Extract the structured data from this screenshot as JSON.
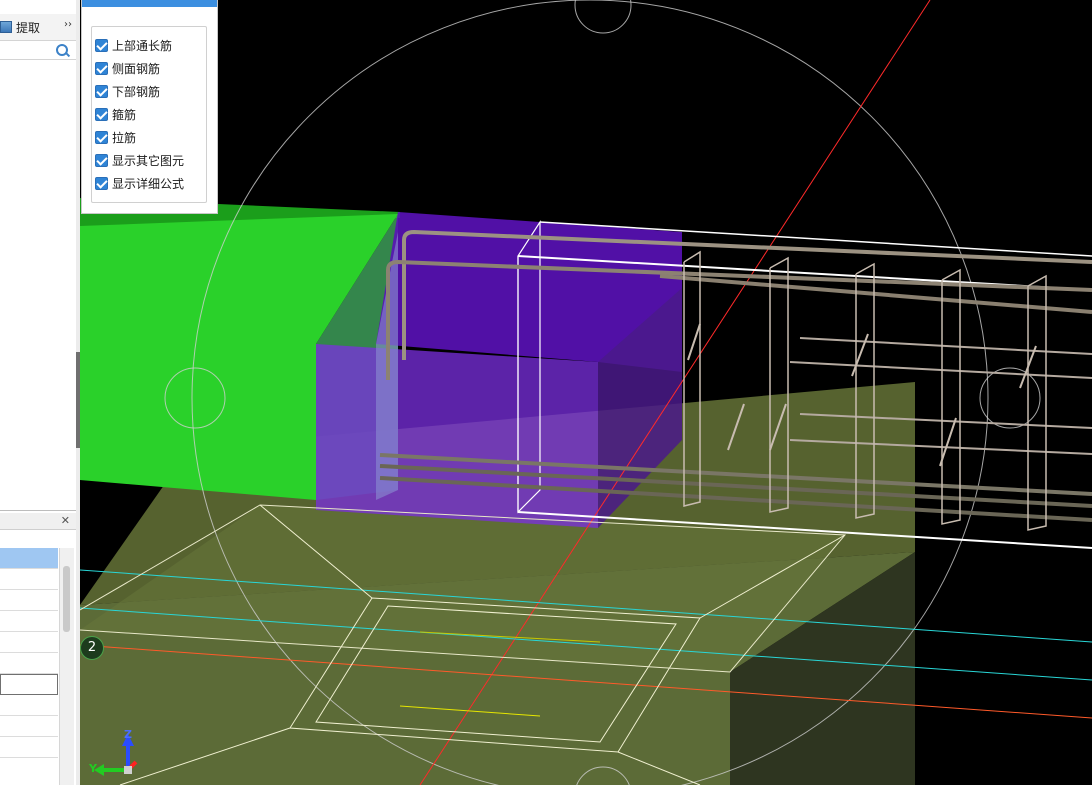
{
  "sidebar": {
    "extract_label": "提取",
    "more_glyph": "››",
    "close_glyph": "✕"
  },
  "layers": {
    "items": [
      {
        "label": "上部通长筋",
        "checked": true
      },
      {
        "label": "侧面钢筋",
        "checked": true
      },
      {
        "label": "下部钢筋",
        "checked": true
      },
      {
        "label": "箍筋",
        "checked": true
      },
      {
        "label": "拉筋",
        "checked": true
      },
      {
        "label": "显示其它图元",
        "checked": true
      },
      {
        "label": "显示详细公式",
        "checked": true
      }
    ]
  },
  "viewport": {
    "axis_number": "2",
    "gizmo": {
      "z": "Z",
      "y": "Y"
    },
    "colors": {
      "background": "#000000",
      "column_green": "#2ecc2e",
      "beam_purple": "#6a1bd6",
      "footing_olive": "#6b7a3a",
      "axis_red": "#ff2a2a",
      "axis_cyan": "#2ad4d4",
      "rebar": "#b8a99a"
    }
  }
}
